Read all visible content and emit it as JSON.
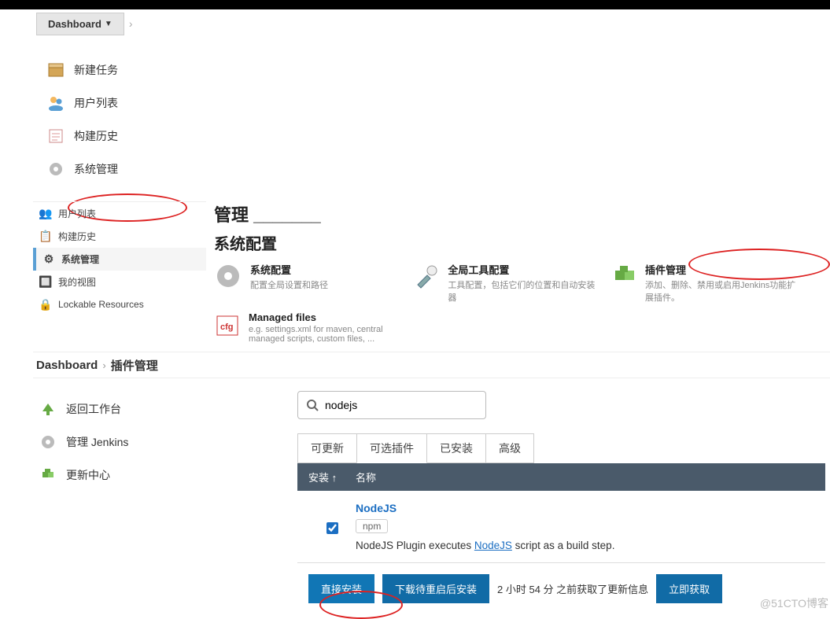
{
  "breadcrumb_top": {
    "dashboard": "Dashboard"
  },
  "sidebar1": [
    {
      "label": "新建任务",
      "name": "new-item",
      "icon": "box-icon"
    },
    {
      "label": "用户列表",
      "name": "people",
      "icon": "people-icon"
    },
    {
      "label": "构建历史",
      "name": "build-history",
      "icon": "clipboard-icon"
    },
    {
      "label": "系统管理",
      "name": "manage-jenkins",
      "icon": "gear-icon"
    }
  ],
  "sidebar2": [
    {
      "label": "用户列表",
      "name": "people",
      "icon": "people-icon"
    },
    {
      "label": "构建历史",
      "name": "build-history",
      "icon": "clipboard-icon"
    },
    {
      "label": "系统管理",
      "name": "manage-jenkins",
      "icon": "gear-icon",
      "active": true
    },
    {
      "label": "我的视图",
      "name": "my-views",
      "icon": "views-icon"
    },
    {
      "label": "Lockable Resources",
      "name": "lockable-resources",
      "icon": "lock-icon"
    }
  ],
  "manage": {
    "h1_partial": "管理 _______",
    "h2": "系统配置",
    "cards": [
      {
        "title": "系统配置",
        "desc": "配置全局设置和路径",
        "icon": "gear-icon"
      },
      {
        "title": "全局工具配置",
        "desc": "工具配置，包括它们的位置和自动安装器",
        "icon": "tools-icon"
      },
      {
        "title": "插件管理",
        "desc": "添加、删除、禁用或启用Jenkins功能扩展插件。",
        "icon": "plugin-icon"
      },
      {
        "title": "Managed files",
        "desc": "e.g. settings.xml for maven, central managed scripts, custom files, ...",
        "icon": "cfg-icon"
      }
    ]
  },
  "breadcrumb3": {
    "dashboard": "Dashboard",
    "plugin": "插件管理"
  },
  "sidebar3": [
    {
      "label": "返回工作台",
      "name": "back-dashboard",
      "icon": "arrow-up-icon"
    },
    {
      "label": "管理 Jenkins",
      "name": "manage-jenkins",
      "icon": "gear-icon"
    },
    {
      "label": "更新中心",
      "name": "update-center",
      "icon": "plugin-icon"
    }
  ],
  "search": {
    "value": "nodejs"
  },
  "tabs": [
    "可更新",
    "可选插件",
    "已安装",
    "高级"
  ],
  "active_tab_index": 1,
  "table": {
    "headers": {
      "install": "安装",
      "name": "名称"
    },
    "sort_arrow": "↑",
    "row": {
      "name": "NodeJS",
      "tag": "npm",
      "desc_pre": "NodeJS Plugin executes ",
      "desc_link": "NodeJS",
      "desc_post": " script as a build step.",
      "checked": true
    }
  },
  "buttons": {
    "install_now": "直接安装",
    "download_restart": "下载待重启后安装",
    "status": "2 小时 54 分 之前获取了更新信息",
    "check_now": "立即获取"
  },
  "watermark": "@51CTO博客"
}
